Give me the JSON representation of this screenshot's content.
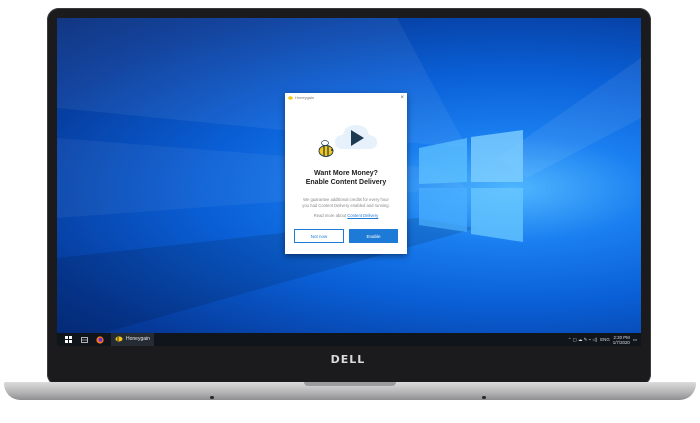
{
  "dialog": {
    "app_name": "Honeygain",
    "heading_line1": "Want More Money?",
    "heading_line2": "Enable Content Delivery",
    "body_line1": "We guarantee additional credits for every hour",
    "body_line2": "you had Content Delivery enabled and running.",
    "read_more_prefix": "Read more about",
    "read_more_link": "Content Delivery",
    "not_now_label": "Not now",
    "enable_label": "Enable"
  },
  "taskbar": {
    "running_app": "Honeygain",
    "language": "ENG",
    "time": "2:30 PM",
    "date": "1/7/2020"
  },
  "brand": {
    "laptop_logo": "DELL"
  },
  "icons": [
    "windows-start-icon",
    "task-view-icon",
    "firefox-icon",
    "honeygain-icon",
    "bee-icon",
    "cloud-play-icon",
    "close-icon",
    "notification-icon"
  ],
  "colors": {
    "accent": "#1d7ad6",
    "desktop_blue": "#0a5fd6",
    "taskbar": "#10151c"
  }
}
